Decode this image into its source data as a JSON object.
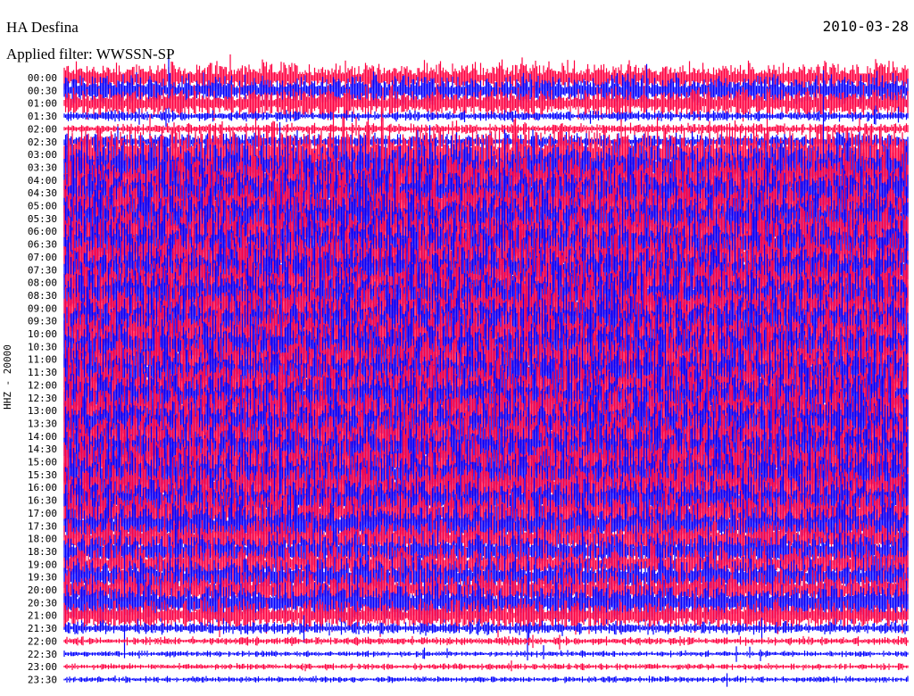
{
  "chart_data": {
    "type": "line",
    "title": "HA Desfina",
    "subtitle": "Applied filter: WWSSN-SP",
    "date": "2010-03-28",
    "ylabel": "HHZ - 20000",
    "row_labels": [
      "00:00",
      "00:30",
      "01:00",
      "01:30",
      "02:00",
      "02:30",
      "03:00",
      "03:30",
      "04:00",
      "04:30",
      "05:00",
      "05:30",
      "06:00",
      "06:30",
      "07:00",
      "07:30",
      "08:00",
      "08:30",
      "09:00",
      "09:30",
      "10:00",
      "10:30",
      "11:00",
      "11:30",
      "12:00",
      "12:30",
      "13:00",
      "13:30",
      "14:00",
      "14:30",
      "15:00",
      "15:30",
      "16:00",
      "16:30",
      "17:00",
      "17:30",
      "18:00",
      "18:30",
      "19:00",
      "19:30",
      "20:00",
      "20:30",
      "21:00",
      "21:30",
      "22:00",
      "22:30",
      "23:00",
      "23:30"
    ],
    "row_relative_amplitude": [
      3,
      3,
      3,
      1,
      1,
      1.5,
      6,
      6,
      6,
      6,
      6,
      6,
      6,
      6,
      6,
      6,
      6,
      6,
      6,
      6,
      6,
      6,
      6,
      6,
      6,
      6,
      6,
      6,
      6,
      6,
      6,
      6,
      6,
      5,
      5,
      5,
      4,
      4,
      4,
      4,
      4,
      4,
      3,
      1.2,
      0.8,
      0.6,
      0.6,
      0.6
    ],
    "series_colors": [
      "#ff0040",
      "#0000ff"
    ]
  }
}
